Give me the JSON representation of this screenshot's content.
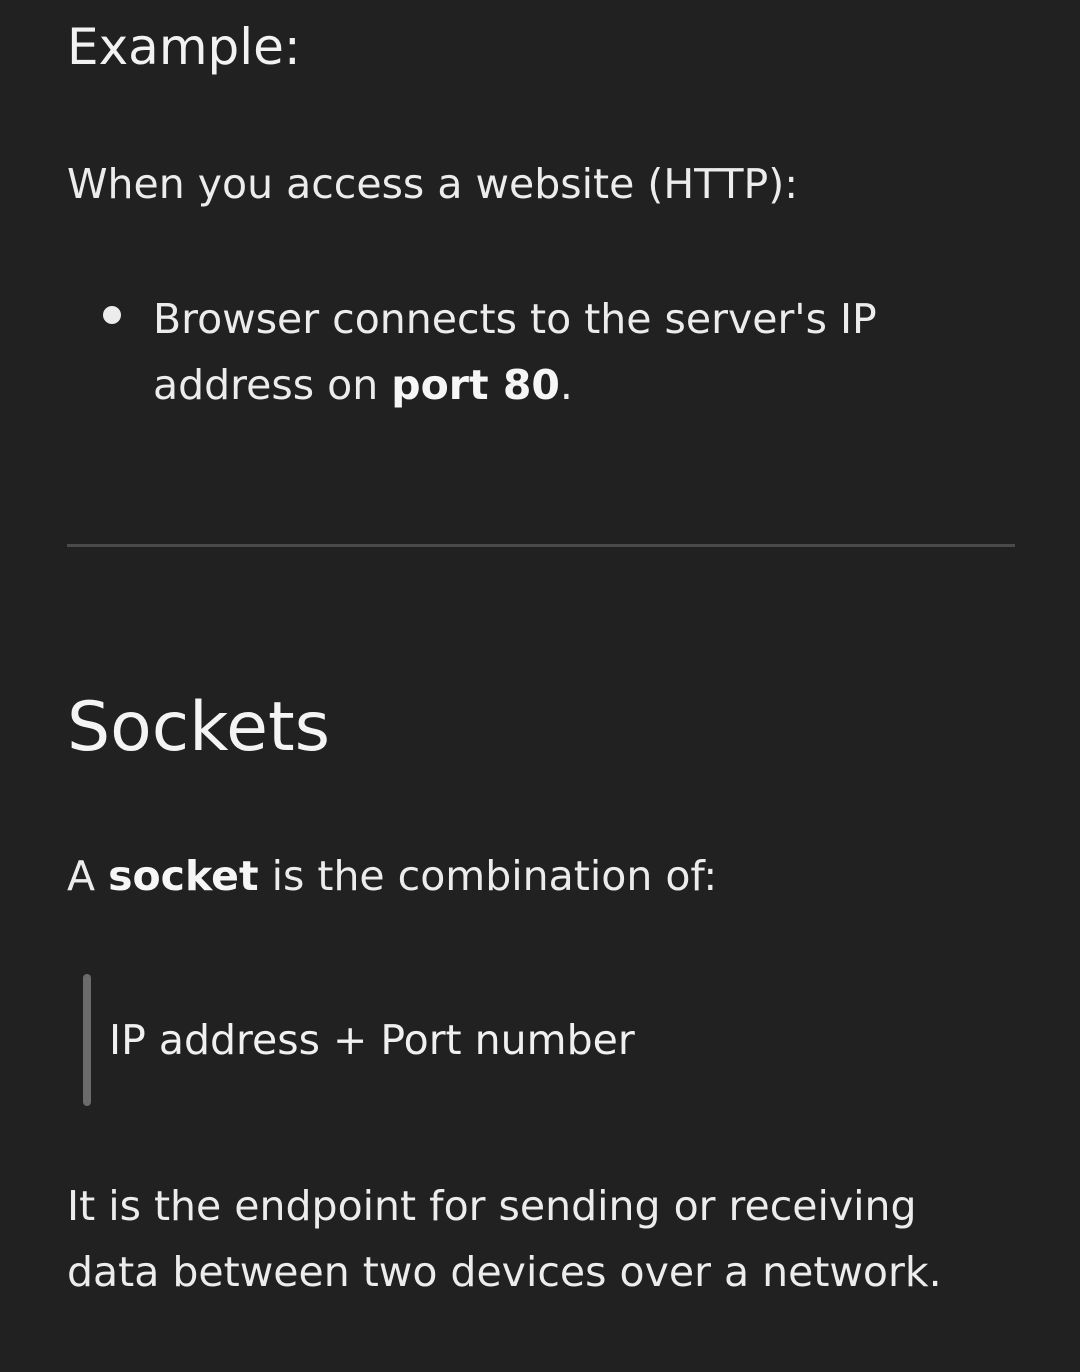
{
  "example": {
    "heading": "Example:",
    "intro": "When you access a website (HTTP):",
    "bullets": [
      {
        "line1": "Browser connects to the server's IP",
        "line2_prefix": "address on ",
        "line2_strong": "port 80",
        "line2_suffix": "."
      }
    ]
  },
  "sockets": {
    "heading": "Sockets",
    "definition_prefix": "A ",
    "definition_strong": "socket",
    "definition_suffix": " is the combination of:",
    "quote": "IP address + Port number",
    "endpoint_line1": "It is the endpoint for sending or receiving",
    "endpoint_line2": "data between two devices over a network."
  }
}
